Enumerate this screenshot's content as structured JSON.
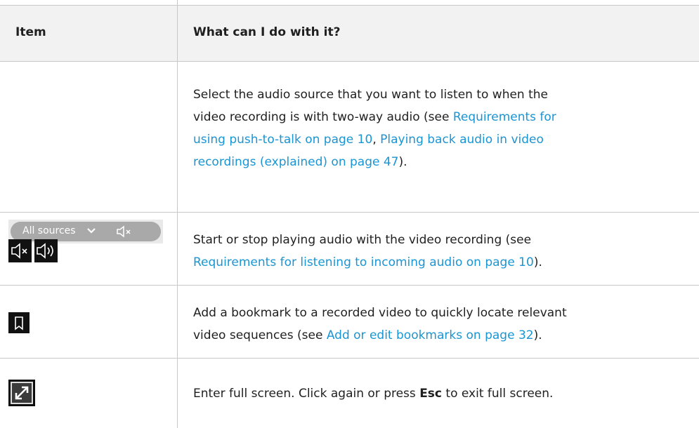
{
  "header": {
    "col1": "Item",
    "col2": "What can I do with it?"
  },
  "rows": [
    {
      "pill": {
        "label": "All sources"
      },
      "segments": [
        {
          "t": "Select the audio source that you want to listen to when the"
        },
        {
          "t": "video recording is with two-way audio (see "
        },
        {
          "t": "Requirements for",
          "link": true
        },
        {
          "t": "using push-to-talk on page 10",
          "link": true
        },
        {
          "t": ", "
        },
        {
          "t": "Playing back audio in video",
          "link": true
        },
        {
          "t": "recordings (explained) on page 47",
          "link": true
        },
        {
          "t": ")."
        }
      ]
    },
    {
      "segments": [
        {
          "t": "Start or stop playing audio with the video recording (see"
        },
        {
          "t": "Requirements for listening to incoming audio on page 10",
          "link": true
        },
        {
          "t": ")."
        }
      ]
    },
    {
      "segments": [
        {
          "t": "Add a bookmark to a recorded video to quickly locate relevant"
        },
        {
          "t": "video sequences (see "
        },
        {
          "t": "Add or edit bookmarks on page 32",
          "link": true
        },
        {
          "t": ")."
        }
      ]
    },
    {
      "segments": [
        {
          "t": "Enter full screen. Click again or press "
        },
        {
          "t": "Esc",
          "bold": true
        },
        {
          "t": " to exit full screen."
        }
      ]
    }
  ],
  "icons": [
    "mute-speaker-icon",
    "speaker-icon",
    "bookmark-icon",
    "fullscreen-icon"
  ],
  "colors": {
    "link": "#1a95d4",
    "header_bg": "#f2f2f2",
    "border": "#c8c8c8"
  }
}
